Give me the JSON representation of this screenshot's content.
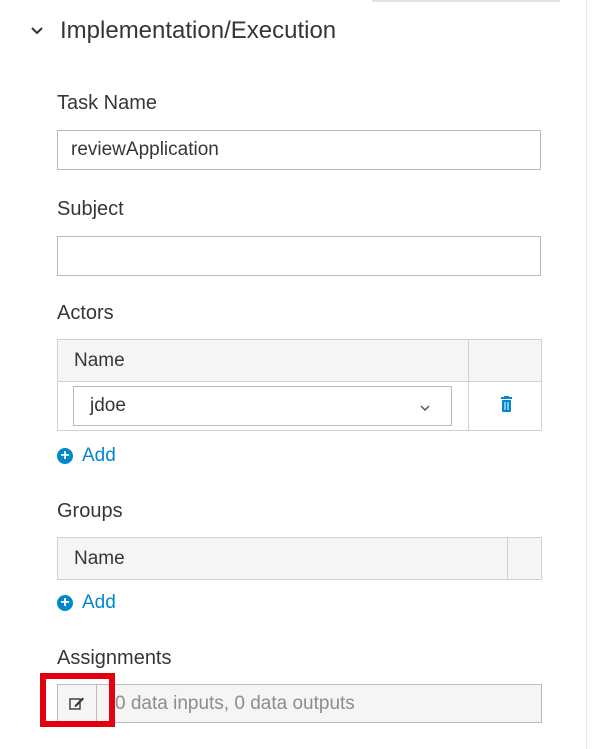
{
  "section": {
    "title": "Implementation/Execution"
  },
  "task_name": {
    "label": "Task Name",
    "value": "reviewApplication"
  },
  "subject": {
    "label": "Subject",
    "value": ""
  },
  "actors": {
    "label": "Actors",
    "column_header": "Name",
    "rows": [
      {
        "value": "jdoe"
      }
    ],
    "add_label": "Add"
  },
  "groups": {
    "label": "Groups",
    "column_header": "Name",
    "add_label": "Add"
  },
  "assignments": {
    "label": "Assignments",
    "summary": "0 data inputs, 0 data outputs"
  },
  "colors": {
    "link": "#0088ce",
    "highlight": "#e5000f"
  }
}
